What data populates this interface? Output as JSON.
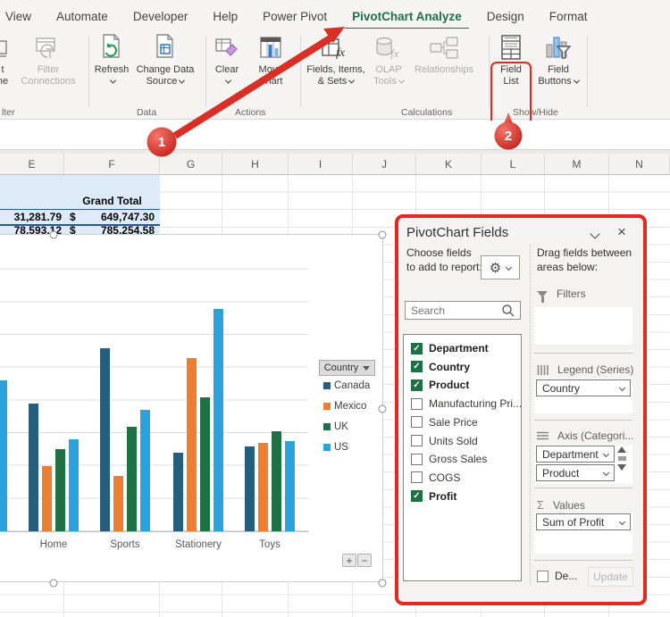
{
  "menubar": {
    "items": [
      {
        "label": "View",
        "active": false
      },
      {
        "label": "Automate",
        "active": false
      },
      {
        "label": "Developer",
        "active": false
      },
      {
        "label": "Help",
        "active": false
      },
      {
        "label": "Power Pivot",
        "active": false
      },
      {
        "label": "PivotChart Analyze",
        "active": true
      },
      {
        "label": "Design",
        "active": false
      },
      {
        "label": "Format",
        "active": false
      }
    ]
  },
  "ribbon": {
    "group_labels": [
      "lter",
      "Data",
      "Actions",
      "Calculations",
      "Show/Hide"
    ],
    "buttons": {
      "insert_timeline_partial": {
        "line1": "t",
        "line2": "ne"
      },
      "filter_connections": {
        "line1": "Filter",
        "line2": "Connections",
        "disabled": true
      },
      "refresh": {
        "line1": "Refresh"
      },
      "change_data_source": {
        "line1": "Change Data",
        "line2": "Source"
      },
      "clear": {
        "line1": "Clear"
      },
      "move_chart": {
        "line1": "Move",
        "line2": "Chart"
      },
      "fields_items_sets": {
        "line1": "Fields, Items,",
        "line2": "& Sets"
      },
      "olap_tools": {
        "line1": "OLAP",
        "line2": "Tools",
        "disabled": true
      },
      "relationships": {
        "line1": "Relationships",
        "disabled": true
      },
      "field_list": {
        "line1": "Field",
        "line2": "List"
      },
      "field_buttons": {
        "line1": "Field",
        "line2": "Buttons"
      }
    }
  },
  "sheet": {
    "columns": [
      "E",
      "F",
      "G",
      "H",
      "I",
      "J",
      "K",
      "L",
      "M",
      "N"
    ],
    "pivot": {
      "grand_total": "Grand Total",
      "row1_e": "31,281.79",
      "row1_f_currency": "$",
      "row1_f": "649,747.30",
      "clipped_e": "78,593.12",
      "clipped_f_currency": "$",
      "clipped_f": "785,254.58"
    }
  },
  "chart": {
    "legend_button": "Country",
    "plus": "+",
    "minus": "−"
  },
  "chart_data": {
    "type": "bar",
    "title": "",
    "xlabel": "",
    "ylabel": "",
    "categories": [
      "Home",
      "Sports",
      "Stationery",
      "Toys"
    ],
    "series": [
      {
        "name": "Canada",
        "color": "#265f7d",
        "values": [
          3.9,
          5.6,
          2.4,
          2.6
        ]
      },
      {
        "name": "Mexico",
        "color": "#ed7d31",
        "values": [
          2.0,
          1.7,
          5.3,
          2.7
        ]
      },
      {
        "name": "UK",
        "color": "#1e7145",
        "values": [
          2.5,
          3.2,
          4.1,
          3.05
        ]
      },
      {
        "name": "US",
        "color": "#2aa3dc",
        "values": [
          2.8,
          3.7,
          6.8,
          2.75
        ]
      }
    ],
    "clipped_left_partial_bar": {
      "series": "US",
      "value": 4.6,
      "note": "category cut off at left edge of screenshot"
    },
    "ylim": [
      0,
      9
    ],
    "y_units": "gridline units (y-axis labels off-screen)",
    "grid": true,
    "legend_title": "Country",
    "legend_position": "right"
  },
  "panel": {
    "title": "PivotChart Fields",
    "choose_label": "Choose fields to add to report:",
    "search_placeholder": "Search",
    "fields": [
      {
        "label": "Department",
        "checked": true
      },
      {
        "label": "Country",
        "checked": true
      },
      {
        "label": "Product",
        "checked": true
      },
      {
        "label": "Manufacturing Pri...",
        "checked": false
      },
      {
        "label": "Sale Price",
        "checked": false
      },
      {
        "label": "Units Sold",
        "checked": false
      },
      {
        "label": "Gross Sales",
        "checked": false
      },
      {
        "label": "COGS",
        "checked": false
      },
      {
        "label": "Profit",
        "checked": true
      }
    ],
    "drag_label": "Drag fields between areas below:",
    "areas": {
      "filters_label": "Filters",
      "legend_label": "Legend (Series)",
      "legend_value": "Country",
      "axis_label": "Axis (Categori...",
      "axis_values": [
        "Department",
        "Product"
      ],
      "values_label": "Values",
      "values_sigma": "Σ",
      "values_value": "Sum of Profit"
    },
    "footer": {
      "defer_label": "De...",
      "update_label": "Update"
    }
  },
  "annotations": {
    "step1": "1",
    "step2": "2",
    "accent": "#e02b20"
  }
}
